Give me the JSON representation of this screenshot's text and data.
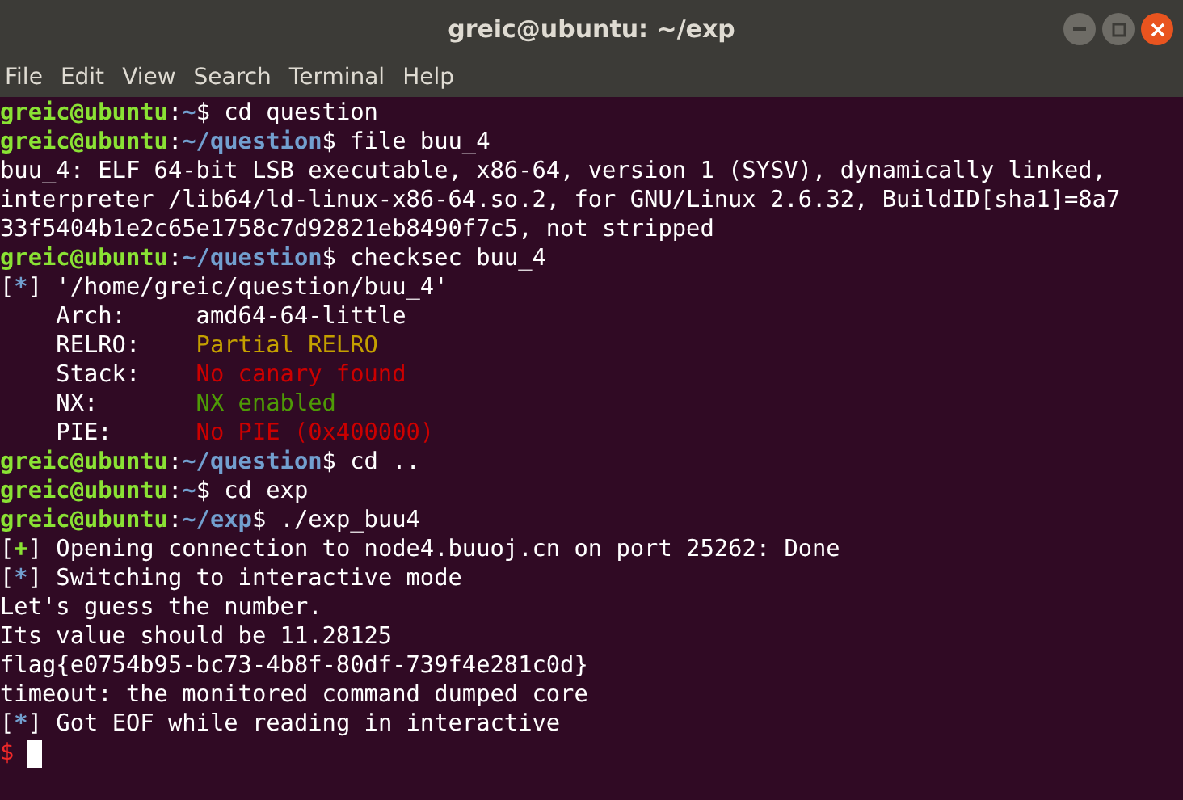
{
  "window": {
    "title": "greic@ubuntu: ~/exp"
  },
  "menu": [
    "File",
    "Edit",
    "View",
    "Search",
    "Terminal",
    "Help"
  ],
  "lines": [
    {
      "segments": [
        {
          "text": "greic@ubuntu",
          "color": "#8ae234"
        },
        {
          "text": ":",
          "color": "#ffffff"
        },
        {
          "text": "~",
          "color": "#729fcf"
        },
        {
          "text": "$ cd question",
          "color": "#ffffff"
        }
      ]
    },
    {
      "segments": [
        {
          "text": "greic@ubuntu",
          "color": "#8ae234"
        },
        {
          "text": ":",
          "color": "#ffffff"
        },
        {
          "text": "~/question",
          "color": "#729fcf"
        },
        {
          "text": "$ file buu_4",
          "color": "#ffffff"
        }
      ]
    },
    {
      "segments": [
        {
          "text": "buu_4: ELF 64-bit LSB executable, x86-64, version 1 (SYSV), dynamically linked,",
          "color": "#ffffff"
        }
      ]
    },
    {
      "segments": [
        {
          "text": "interpreter /lib64/ld-linux-x86-64.so.2, for GNU/Linux 2.6.32, BuildID[sha1]=8a7",
          "color": "#ffffff"
        }
      ]
    },
    {
      "segments": [
        {
          "text": "33f5404b1e2c65e1758c7d92821eb8490f7c5, not stripped",
          "color": "#ffffff"
        }
      ]
    },
    {
      "segments": [
        {
          "text": "greic@ubuntu",
          "color": "#8ae234"
        },
        {
          "text": ":",
          "color": "#ffffff"
        },
        {
          "text": "~/question",
          "color": "#729fcf"
        },
        {
          "text": "$ checksec buu_4",
          "color": "#ffffff"
        }
      ]
    },
    {
      "segments": [
        {
          "text": "[",
          "color": "#ffffff"
        },
        {
          "text": "*",
          "color": "#729fcf"
        },
        {
          "text": "] '/home/greic/question/buu_4'",
          "color": "#ffffff"
        }
      ]
    },
    {
      "segments": [
        {
          "text": "    Arch:     amd64-64-little",
          "color": "#ffffff"
        }
      ]
    },
    {
      "segments": [
        {
          "text": "    RELRO:    ",
          "color": "#ffffff"
        },
        {
          "text": "Partial RELRO",
          "color": "#c4a000"
        }
      ]
    },
    {
      "segments": [
        {
          "text": "    Stack:    ",
          "color": "#ffffff"
        },
        {
          "text": "No canary found",
          "color": "#cc0000"
        }
      ]
    },
    {
      "segments": [
        {
          "text": "    NX:       ",
          "color": "#ffffff"
        },
        {
          "text": "NX enabled",
          "color": "#4e9a06"
        }
      ]
    },
    {
      "segments": [
        {
          "text": "    PIE:      ",
          "color": "#ffffff"
        },
        {
          "text": "No PIE (0x400000)",
          "color": "#cc0000"
        }
      ]
    },
    {
      "segments": [
        {
          "text": "greic@ubuntu",
          "color": "#8ae234"
        },
        {
          "text": ":",
          "color": "#ffffff"
        },
        {
          "text": "~/question",
          "color": "#729fcf"
        },
        {
          "text": "$ cd ..",
          "color": "#ffffff"
        }
      ]
    },
    {
      "segments": [
        {
          "text": "greic@ubuntu",
          "color": "#8ae234"
        },
        {
          "text": ":",
          "color": "#ffffff"
        },
        {
          "text": "~",
          "color": "#729fcf"
        },
        {
          "text": "$ cd exp",
          "color": "#ffffff"
        }
      ]
    },
    {
      "segments": [
        {
          "text": "greic@ubuntu",
          "color": "#8ae234"
        },
        {
          "text": ":",
          "color": "#ffffff"
        },
        {
          "text": "~/exp",
          "color": "#729fcf"
        },
        {
          "text": "$ ./exp_buu4",
          "color": "#ffffff"
        }
      ]
    },
    {
      "segments": [
        {
          "text": "[",
          "color": "#ffffff"
        },
        {
          "text": "+",
          "color": "#8ae234"
        },
        {
          "text": "] Opening connection to node4.buuoj.cn on port 25262: Done",
          "color": "#ffffff"
        }
      ]
    },
    {
      "segments": [
        {
          "text": "[",
          "color": "#ffffff"
        },
        {
          "text": "*",
          "color": "#729fcf"
        },
        {
          "text": "] Switching to interactive mode",
          "color": "#ffffff"
        }
      ]
    },
    {
      "segments": [
        {
          "text": "Let's guess the number.",
          "color": "#ffffff"
        }
      ]
    },
    {
      "segments": [
        {
          "text": "Its value should be 11.28125",
          "color": "#ffffff"
        }
      ]
    },
    {
      "segments": [
        {
          "text": "flag{e0754b95-bc73-4b8f-80df-739f4e281c0d}",
          "color": "#ffffff"
        }
      ]
    },
    {
      "segments": [
        {
          "text": "timeout: the monitored command dumped core",
          "color": "#ffffff"
        }
      ]
    },
    {
      "segments": [
        {
          "text": "[",
          "color": "#ffffff"
        },
        {
          "text": "*",
          "color": "#729fcf"
        },
        {
          "text": "] Got EOF while reading in interactive",
          "color": "#ffffff"
        }
      ]
    },
    {
      "segments": [
        {
          "text": "$ ",
          "color": "#ef2929"
        }
      ],
      "cursor": true
    }
  ]
}
